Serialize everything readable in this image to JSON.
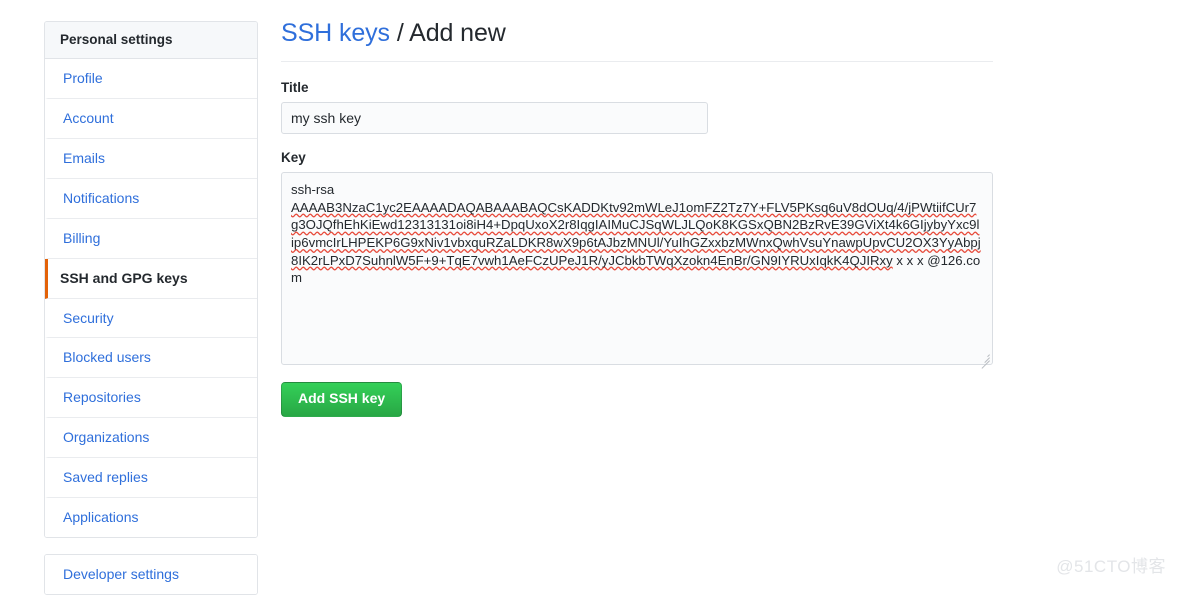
{
  "sidebar": {
    "heading": "Personal settings",
    "items": [
      {
        "label": "Profile",
        "active": false
      },
      {
        "label": "Account",
        "active": false
      },
      {
        "label": "Emails",
        "active": false
      },
      {
        "label": "Notifications",
        "active": false
      },
      {
        "label": "Billing",
        "active": false
      },
      {
        "label": "SSH and GPG keys",
        "active": true
      },
      {
        "label": "Security",
        "active": false
      },
      {
        "label": "Blocked users",
        "active": false
      },
      {
        "label": "Repositories",
        "active": false
      },
      {
        "label": "Organizations",
        "active": false
      },
      {
        "label": "Saved replies",
        "active": false
      },
      {
        "label": "Applications",
        "active": false
      }
    ],
    "developer_settings": "Developer settings",
    "active_indicator_color": "#e36209",
    "link_color": "#2f6fdb",
    "heading_bg": "#f6f8fa"
  },
  "header": {
    "breadcrumb_link": "SSH keys",
    "separator": " / ",
    "current": "Add new"
  },
  "form": {
    "title_label": "Title",
    "title_value": "my ssh key",
    "title_placeholder": "",
    "key_label": "Key",
    "key_value": "ssh-rsa\nAAAAB3NzaC1yc2EAAAADAQABAAABAQCsKADDKtv92mWLeJ1omFZ2Tz7Y+FLV5PKsq6uV8dOUq/4/jPWtiifCUr7g3OJQfhEhKiEwd12313131oi8iH4+DpqUxoX2r8IqgIAIMuCJSqWLJLQoK8KGSxQBN2BzRvE39GViXt4k6GIjybyYxc9lip6vmcIrLHPEKP6G9xNiv1vbxquRZaLDKR8wX9p6tAJbzMNUl/YuIhGZxxbzMWnxQwhVsuYnawpUpvCU2OX3YyAbpj8IK2rLPxD7SuhnlW5F+9+TqE7vwh1AeFCzUPeJ1R/yJCbkbTWqXzokn4EnBr/GN9IYRUxIqkK4QJIRxy x x x @126.com",
    "key_placeholder": "",
    "submit_label": "Add SSH key",
    "submit_color": "#2cbe4e"
  },
  "watermark": "@51CTO博客"
}
